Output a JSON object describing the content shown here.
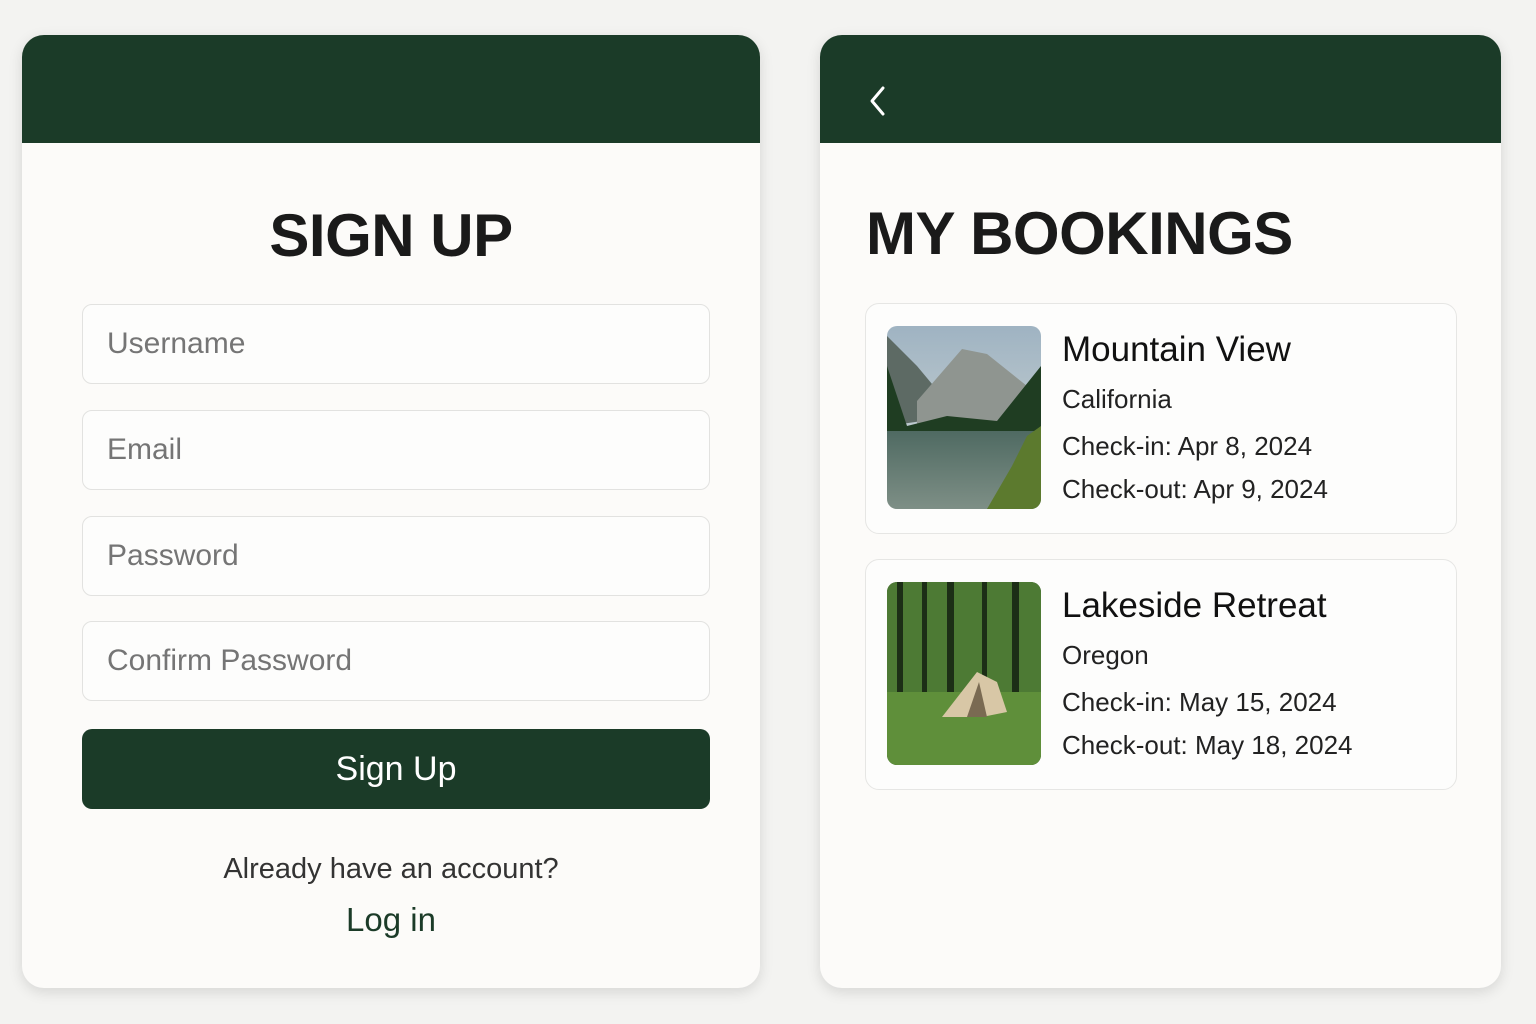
{
  "signup": {
    "title": "SIGN UP",
    "fields": [
      {
        "placeholder": "Username"
      },
      {
        "placeholder": "Email"
      },
      {
        "placeholder": "Password"
      },
      {
        "placeholder": "Confirm Password"
      }
    ],
    "submit_label": "Sign Up",
    "already_text": "Already have an account?",
    "login_link": "Log in"
  },
  "bookings": {
    "back_icon": "chevron-left-icon",
    "title": "MY BOOKINGS",
    "items": [
      {
        "name": "Mountain View",
        "location": "California",
        "checkin": "Check-in: Apr 8, 2024",
        "checkout": "Check-out: Apr 9, 2024",
        "image": "mountain-lake"
      },
      {
        "name": "Lakeside Retreat",
        "location": "Oregon",
        "checkin": "Check-in: May 15, 2024",
        "checkout": "Check-out: May 18, 2024",
        "image": "forest-tent"
      }
    ]
  },
  "colors": {
    "primary": "#1b3b28",
    "background": "#f3f3f1",
    "card": "#fcfbf9"
  }
}
